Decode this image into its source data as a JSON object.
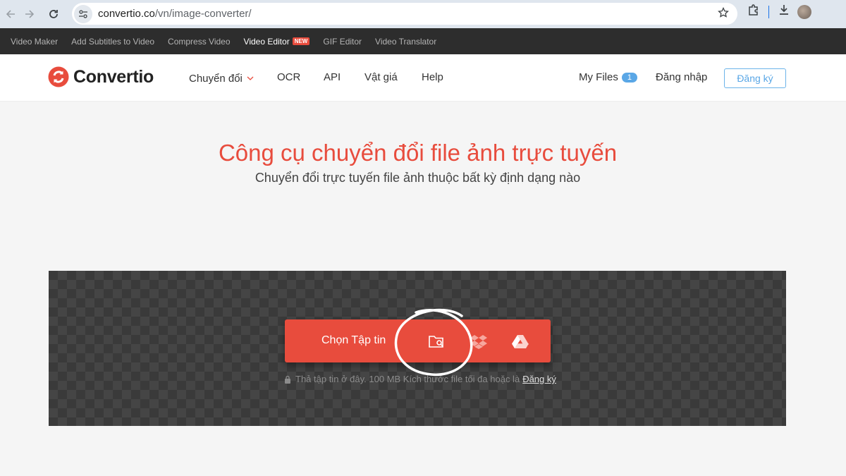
{
  "browser": {
    "url_host": "convertio.co",
    "url_path": "/vn/image-converter/"
  },
  "promo_links": [
    {
      "label": "Video Maker"
    },
    {
      "label": "Add Subtitles to Video"
    },
    {
      "label": "Compress Video"
    },
    {
      "label": "Video Editor",
      "badge": "NEW"
    },
    {
      "label": "GIF Editor"
    },
    {
      "label": "Video Translator"
    }
  ],
  "header": {
    "logo": "Convertio",
    "menu": [
      "Chuyển đổi",
      "OCR",
      "API",
      "Vật giá",
      "Help"
    ],
    "my_files_label": "My Files",
    "my_files_count": "1",
    "login_label": "Đăng nhập",
    "signup_label": "Đăng ký"
  },
  "hero": {
    "title": "Công cụ chuyển đổi file ảnh trực tuyến",
    "subtitle": "Chuyển đổi trực tuyến file ảnh thuộc bất kỳ định dạng nào"
  },
  "upload": {
    "choose_label": "Chọn Tập tin",
    "hint_text": "Thả tập tin ở đây. 100 MB Kích thước file tối đa hoặc là",
    "hint_link": "Đăng ký"
  },
  "icons": [
    "back-icon",
    "forward-icon",
    "reload-icon",
    "site-settings-icon",
    "star-icon",
    "extensions-icon",
    "download-icon",
    "folder-search-icon",
    "dropbox-icon",
    "google-drive-icon",
    "lock-icon"
  ],
  "colors": {
    "brand": "#e84c3d",
    "link_blue": "#5aa7e6",
    "dark_strip": "#2d2d2d",
    "panel": "#3a3a3a"
  }
}
